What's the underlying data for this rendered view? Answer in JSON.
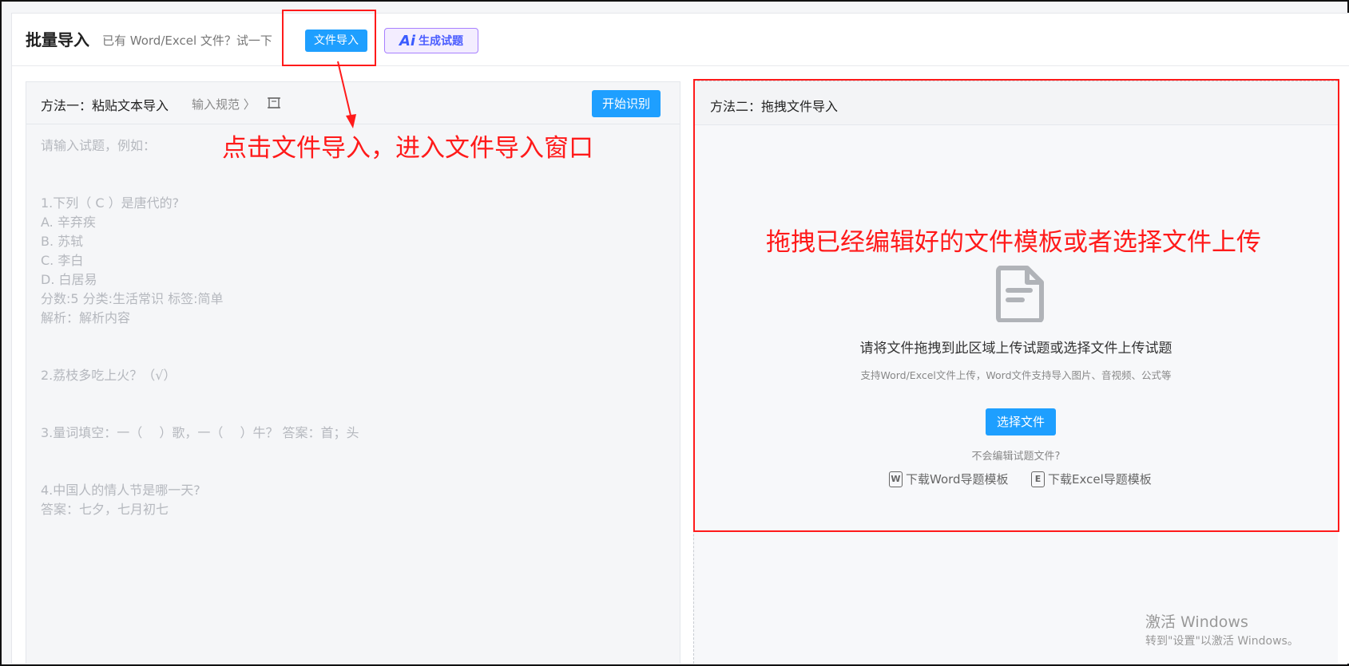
{
  "header": {
    "title": "批量导入",
    "hint": "已有 Word/Excel 文件？试一下",
    "import_button": "文件导入",
    "ai_logo": "Ai",
    "ai_button": "生成试题"
  },
  "method1": {
    "title": "方法一：粘贴文本导入",
    "spec_link": "输入规范 〉",
    "format_icon": "format-icon",
    "start_button": "开始识别",
    "sample_lines": [
      "请输入试题，例如：",
      "",
      "",
      "1.下列（ C ）是唐代的?",
      "A. 辛弃疾",
      "B. 苏轼",
      "C. 李白",
      "D. 白居易",
      "分数:5 分类:生活常识 标签:简单",
      "解析：解析内容",
      "",
      "",
      "2.荔枝多吃上火？（√）",
      "",
      "",
      "3.量词填空：一（　 ）歌，一（　 ）牛？ 答案：首；头",
      "",
      "",
      "4.中国人的情人节是哪一天?",
      "答案：七夕，七月初七"
    ]
  },
  "method2": {
    "title": "方法二：拖拽文件导入",
    "file_icon": "document-icon",
    "drop_text": "请将文件拖拽到此区域上传试题或选择文件上传试题",
    "support_text": "支持Word/Excel文件上传，Word文件支持导入图片、音视频、公式等",
    "choose_button": "选择文件",
    "not_know": "不会编辑试题文件?",
    "word_badge": "W",
    "word_template": "下载Word导题模板",
    "excel_badge": "E",
    "excel_template": "下载Excel导题模板"
  },
  "annotations": {
    "click_hint": "点击文件导入，进入文件导入窗口",
    "drag_hint": "拖拽已经编辑好的文件模板或者选择文件上传",
    "color": "#ff1a1a"
  },
  "watermark": {
    "line1": "激活 Windows",
    "line2": "转到\"设置\"以激活 Windows。"
  },
  "colors": {
    "primary": "#1e9fff",
    "ai_border": "#a880ff"
  }
}
